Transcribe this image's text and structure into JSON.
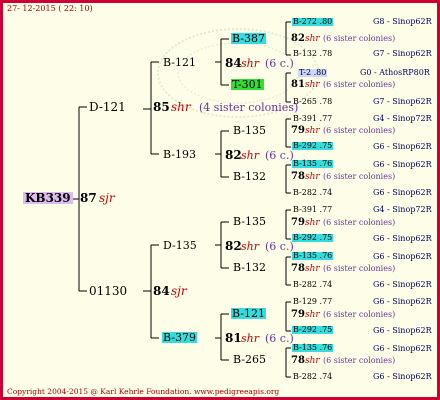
{
  "header": {
    "date": "27- 12-2015 ( 22: 10)"
  },
  "footer": {
    "copyright": "Copyright 2004-2015 @ Karl Kehrle Foundation.   www.pedigreeapis.org"
  },
  "root": {
    "id": "KB339",
    "num": "87",
    "suffix": "sjr"
  },
  "gen1": {
    "top": {
      "id": "D-121",
      "num": "85",
      "suffix": "shr",
      "note": "(4 sister colonies)"
    },
    "bottom": {
      "id": "01130",
      "num": "84",
      "suffix": "sjr"
    }
  },
  "gen2": {
    "a": {
      "id": "B-121"
    },
    "b": {
      "id": "B-193",
      "num": "82",
      "suffix": "shr",
      "note": "(6 c.)"
    },
    "c": {
      "id": "D-135",
      "num": "82",
      "suffix": "shr",
      "note": "(6 c.)"
    },
    "d": {
      "id": "B-379"
    },
    "a_child": {
      "num": "84",
      "suffix": "shr",
      "note": "(6 c.)"
    },
    "d_child": {
      "num": "81",
      "suffix": "shr",
      "note": "(6 c.)"
    }
  },
  "gen3": {
    "g1": "B-387",
    "g2": "T-301",
    "g3": "B-135",
    "g4": "B-132",
    "g5": "B-135",
    "g6": "B-132",
    "g7": "B-121",
    "g8": "B-265"
  },
  "gen3_children": {
    "c1": {
      "num": "82",
      "suffix": "shr",
      "note": "(6 sister colonies)"
    },
    "c2": {
      "num": "81",
      "suffix": "shr",
      "note": "(6 sister colonies)"
    },
    "c3": {
      "num": "79",
      "suffix": "shr",
      "note": "(6 sister colonies)"
    },
    "c4": {
      "num": "78",
      "suffix": "shr",
      "note": "(6 sister colonies)"
    },
    "c5": {
      "num": "79",
      "suffix": "shr",
      "note": "(6 sister colonies)"
    },
    "c6": {
      "num": "78",
      "suffix": "shr",
      "note": "(6 sister colonies)"
    },
    "c7": {
      "num": "79",
      "suffix": "shr",
      "note": "(6 sister colonies)"
    },
    "c8": {
      "num": "78",
      "suffix": "shr",
      "note": "(6 sister colonies)"
    }
  },
  "gen4": [
    {
      "id": "B-272 .80",
      "loc": "G8 - Sinop62R"
    },
    {
      "id": "B-132 .78",
      "loc": "G7 - Sinop62R"
    },
    {
      "id": "T-2 .80",
      "loc": "G0 - AthosRP80R"
    },
    {
      "id": "B-265 .78",
      "loc": "G7 - Sinop62R"
    },
    {
      "id": "B-391 .77",
      "loc": "G4 - Sinop72R"
    },
    {
      "id": "B-292 .75",
      "loc": "G6 - Sinop62R"
    },
    {
      "id": "B-135 .76",
      "loc": "G6 - Sinop62R"
    },
    {
      "id": "B-282 .74",
      "loc": "G6 - Sinop62R"
    },
    {
      "id": "B-391 .77",
      "loc": "G4 - Sinop72R"
    },
    {
      "id": "B-292 .75",
      "loc": "G6 - Sinop62R"
    },
    {
      "id": "B-135 .76",
      "loc": "G6 - Sinop62R"
    },
    {
      "id": "B-282 .74",
      "loc": "G6 - Sinop62R"
    },
    {
      "id": "B-129 .77",
      "loc": "G6 - Sinop62R"
    },
    {
      "id": "B-292 .75",
      "loc": "G6 - Sinop62R"
    },
    {
      "id": "B-135 .76",
      "loc": "G6 - Sinop62R"
    },
    {
      "id": "B-282 .74",
      "loc": "G6 - Sinop62R"
    }
  ],
  "colors": {
    "border": "#cc0033",
    "background": "#fefee8",
    "highlight_cyan": "#33dddd",
    "highlight_green": "#33dd33",
    "root_bg": "#ddbbee"
  }
}
